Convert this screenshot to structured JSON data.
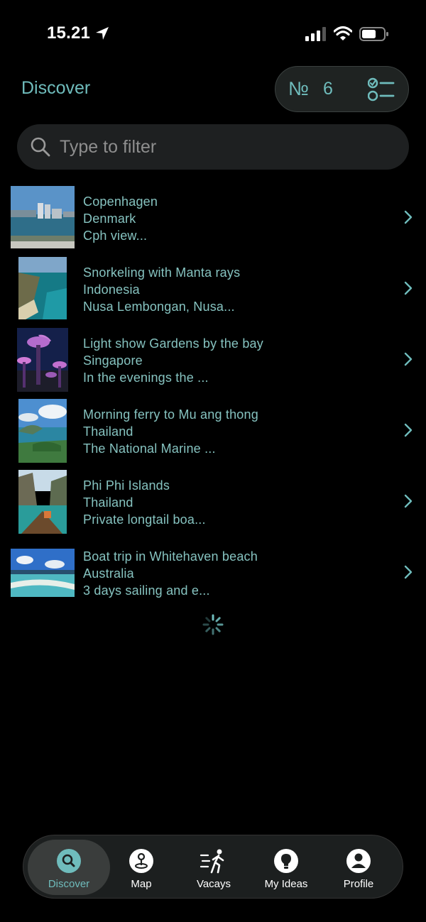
{
  "status": {
    "time": "15.21"
  },
  "header": {
    "title": "Discover",
    "count_prefix": "№",
    "count": "6"
  },
  "search": {
    "placeholder": "Type to filter",
    "value": ""
  },
  "items": [
    {
      "title": "Copenhagen",
      "country": "Denmark",
      "description": "Cph view..."
    },
    {
      "title": "Snorkeling with Manta rays",
      "country": "Indonesia",
      "description": "Nusa Lembongan, Nusa..."
    },
    {
      "title": "Light show Gardens by the bay",
      "country": "Singapore",
      "description": "In the evenings the ..."
    },
    {
      "title": "Morning ferry to Mu ang thong",
      "country": "Thailand",
      "description": "The National Marine ..."
    },
    {
      "title": "Phi Phi Islands",
      "country": "Thailand",
      "description": "Private longtail boa..."
    },
    {
      "title": "Boat trip in Whitehaven beach",
      "country": "Australia",
      "description": "3 days sailing and e..."
    }
  ],
  "tabs": [
    {
      "label": "Discover",
      "icon": "search-icon"
    },
    {
      "label": "Map",
      "icon": "map-pin-icon"
    },
    {
      "label": "Vacays",
      "icon": "walking-person-icon"
    },
    {
      "label": "My Ideas",
      "icon": "lightbulb-icon"
    },
    {
      "label": "Profile",
      "icon": "person-icon"
    }
  ],
  "colors": {
    "accent": "#6fbcbc",
    "item_text": "#86c3c0",
    "background": "#000000"
  }
}
